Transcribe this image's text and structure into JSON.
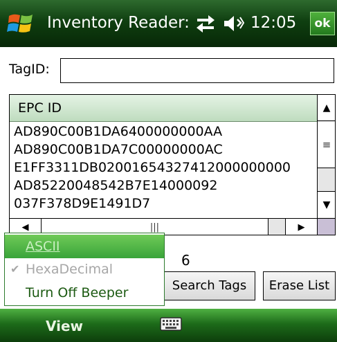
{
  "titlebar": {
    "title": "Inventory Reader:",
    "time": "12:05",
    "ok_label": "ok",
    "icons": [
      "windows-start-icon",
      "connectivity-icon",
      "volume-icon"
    ]
  },
  "tag": {
    "label": "TagID:",
    "value": ""
  },
  "list": {
    "column_header": "EPC ID",
    "rows": [
      "AD890C00B1DA6400000000AA",
      "AD890C00B1DA7C00000000AC",
      "E1FF3311DB02001654327412000000000",
      "AD85220048542B7E14000092",
      "037F378D9E1491D7"
    ],
    "scroll_icons": [
      "up-arrow-icon",
      "thumb-grip-icon",
      "down-arrow-icon",
      "left-arrow-icon",
      "right-arrow-icon"
    ]
  },
  "count": "6",
  "buttons": {
    "search": "Search Tags",
    "erase": "Erase List"
  },
  "menu": {
    "items": [
      {
        "label": "ASCII",
        "state": "highlighted"
      },
      {
        "label": "HexaDecimal",
        "state": "disabled-checked"
      },
      {
        "label": "Turn Off Beeper",
        "state": "normal"
      }
    ]
  },
  "menubar": {
    "left_label": "View",
    "center_icon": "keyboard-icon"
  },
  "colors": {
    "titlebar": "#0f3f10",
    "menu_highlight": "#39a43a",
    "menubar": "#1d6b1a"
  }
}
